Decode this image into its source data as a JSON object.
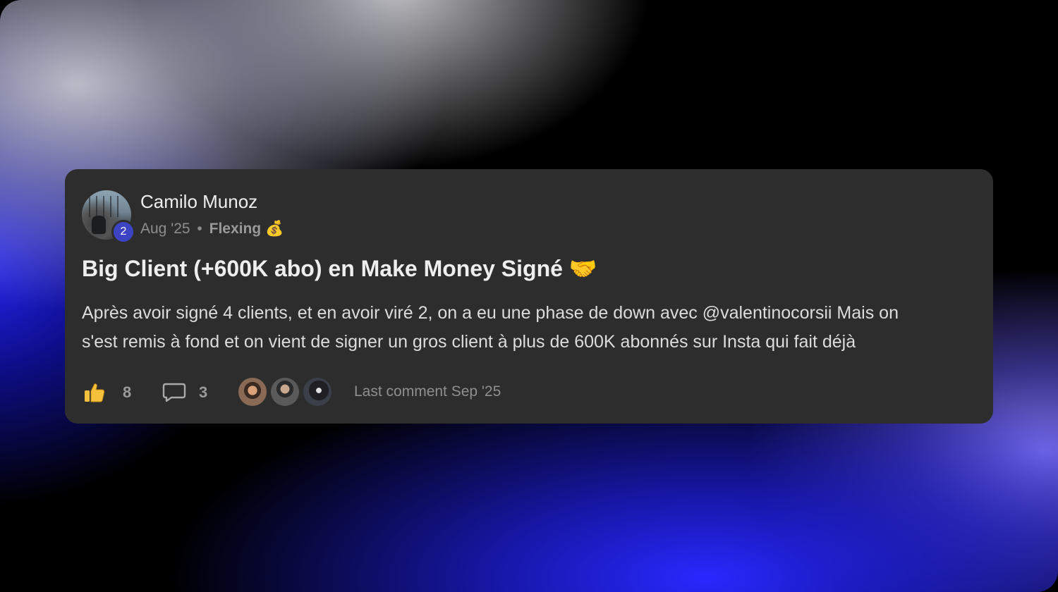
{
  "post": {
    "author": "Camilo Munoz",
    "level": "2",
    "date": "Aug '25",
    "separator": "•",
    "category": "Flexing",
    "category_emoji": "💰",
    "title": "Big Client (+600K abo) en Make Money Signé 🤝",
    "body_lines": [
      "Après avoir signé 4 clients, et en avoir viré 2, on a eu une phase de down avec @valentinocorsii Mais on",
      "s'est remis à fond et on vient de signer un gros client à plus de 600K abonnés sur Insta qui fait déjà"
    ],
    "likes": "8",
    "comments": "3",
    "last_comment": "Last comment Sep '25"
  },
  "icons": {
    "like": "thumbs-up-icon",
    "comment": "comment-bubble-icon"
  },
  "colors": {
    "card_bg": "#2d2d2d",
    "level_badge": "#3d44c3",
    "like_icon": "#f5c13c"
  }
}
